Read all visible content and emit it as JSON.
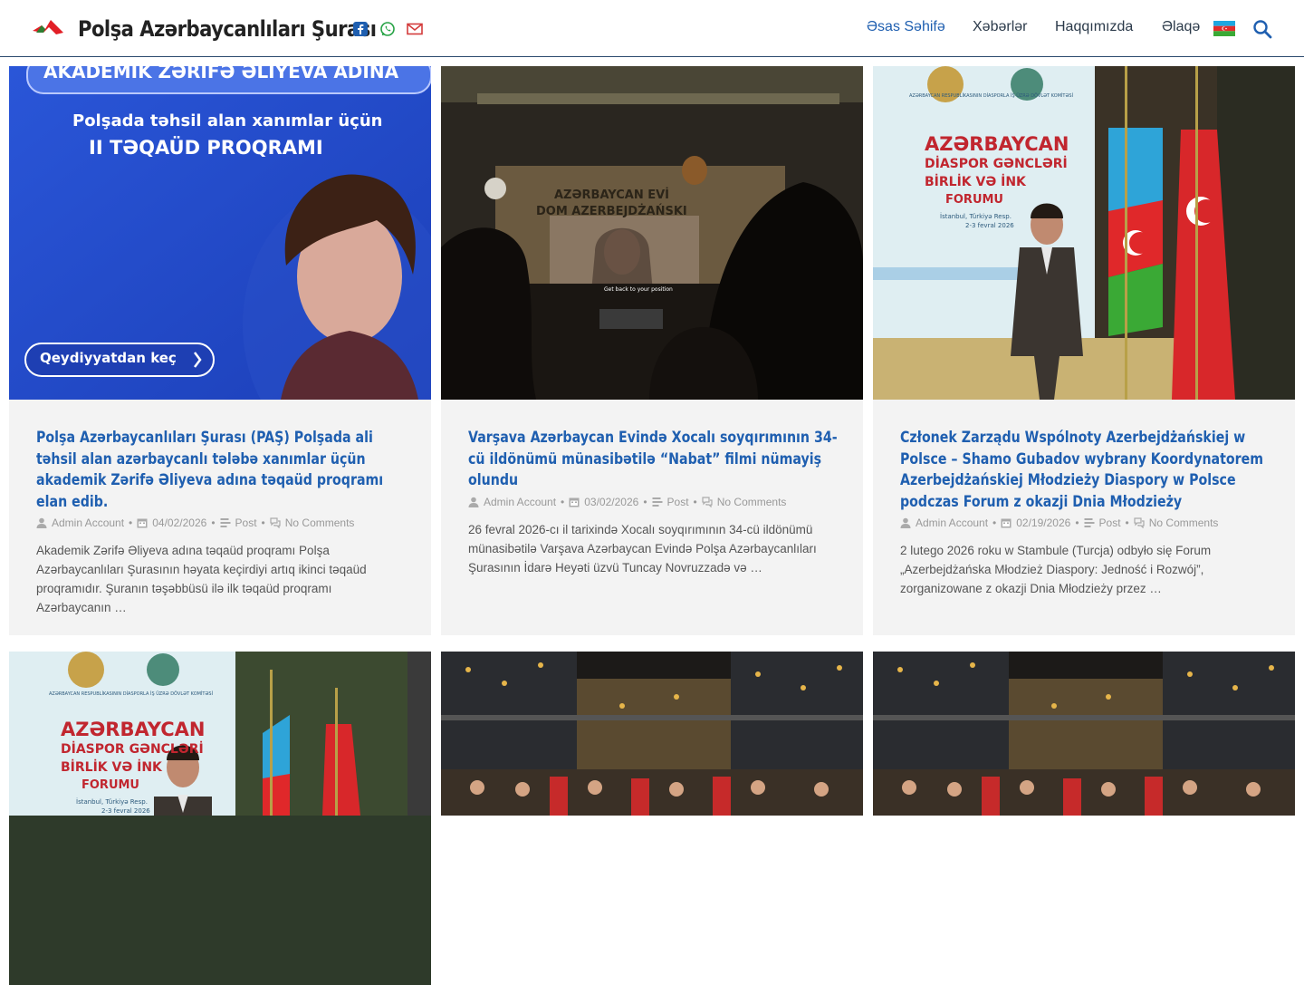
{
  "header": {
    "site_title": "Polşa Azərbaycanlıları Şurası",
    "nav": [
      "Əsas Səhifə",
      "Xəbərlər",
      "Haqqımızda",
      "Əlaqə"
    ],
    "active_color": "#1f5fb0"
  },
  "posts": [
    {
      "title": "Polşa Azərbaycanlıları Şurası (PAŞ) Polşada ali təhsil alan azərbaycanlı tələbə xanımlar üçün akademik Zərifə Əliyeva adına təqaüd proqramı elan edib.",
      "author": "Admin Account",
      "date": "04/02/2026",
      "type": "Post",
      "comments": "No Comments",
      "excerpt": "Akademik Zərifə Əliyeva adına təqaüd proqramı Polşa Azərbaycanlıları Şurasının həyata keçirdiyi artıq ikinci təqaüd proqramıdır. Şuranın təşəbbüsü ilə ilk təqaüd proqramı Azərbaycanın …",
      "image_text": {
        "banner": "AKADEMİK ZƏRİFƏ ƏLİYEVA ADINA",
        "line1": "Polşada təhsil alan xanımlar üçün",
        "line2": "II TƏQAÜD PROQRAMI",
        "button": "Qeydiyyatdan keç"
      }
    },
    {
      "title": "Varşava Azərbaycan Evində Xocalı soyqırımının 34-cü ildönümü münasibətilə “Nabat” filmi nümayiş olundu",
      "author": "Admin Account",
      "date": "03/02/2026",
      "type": "Post",
      "comments": "No Comments",
      "excerpt": "26 fevral 2026-cı il tarixində Xocalı soyqırımının 34-cü ildönümü münasibətilə Varşava Azərbaycan Evində Polşa Azərbaycanlıları Şurasının İdarə Heyəti üzvü Tuncay Novruzzadə və …",
      "image_text": {
        "wall1": "AZƏRBAYCAN EVİ",
        "wall2": "DOM AZERBEJDŻAŃSKI",
        "subtitle": "Get back to your position"
      }
    },
    {
      "title": "Członek Zarządu Wspólnoty Azerbejdżańskiej w Polsce – Shamo Gubadov wybrany Koordynatorem Azerbejdżańskiej Młodzieży Diaspory w Polsce podczas Forum z okazji Dnia Młodzieży",
      "author": "Admin Account",
      "date": "02/19/2026",
      "type": "Post",
      "comments": "No Comments",
      "excerpt": "2 lutego 2026 roku w Stambule (Turcja) odbyło się Forum „Azerbejdżańska Młodzież Diaspory: Jedność i Rozwój”, zorganizowane z okazji Dnia Młodzieży przez …",
      "image_text": {
        "top": "AZƏRBAYCAN RESPUBLİKASININ DİASPORLA İŞ ÜZRƏ DÖVLƏT KOMİTƏSİ",
        "big1": "AZƏRBAYCAN",
        "big2": "DİASPOR GƏNCLƏRİ",
        "big3": "BİRLİK VƏ İNK",
        "big4": "FORUMU",
        "place": "İstanbul, Türkiyə Resp.",
        "date": "2-3 fevral 2026"
      }
    },
    {
      "image_text": {
        "top": "AZƏRBAYCAN RESPUBLİKASININ DİASPORLA İŞ ÜZRƏ DÖVLƏT KOMİTƏSİ",
        "big1": "AZƏRBAYCAN",
        "big2": "DİASPOR GƏNCLƏRİ",
        "big3": "BİRLİK VƏ İNK",
        "big4": "FORUMU",
        "place": "İstanbul, Türkiyə Resp.",
        "date": "2-3 fevral 2026"
      }
    },
    {},
    {}
  ],
  "icons": {
    "logo": "logo-icon",
    "facebook": "facebook-icon",
    "whatsapp": "whatsapp-icon",
    "mail": "mail-icon",
    "flag": "azerbaijan-flag-icon",
    "search": "search-icon",
    "author": "user-icon",
    "date": "calendar-icon",
    "type": "list-icon",
    "comments": "comments-icon"
  }
}
